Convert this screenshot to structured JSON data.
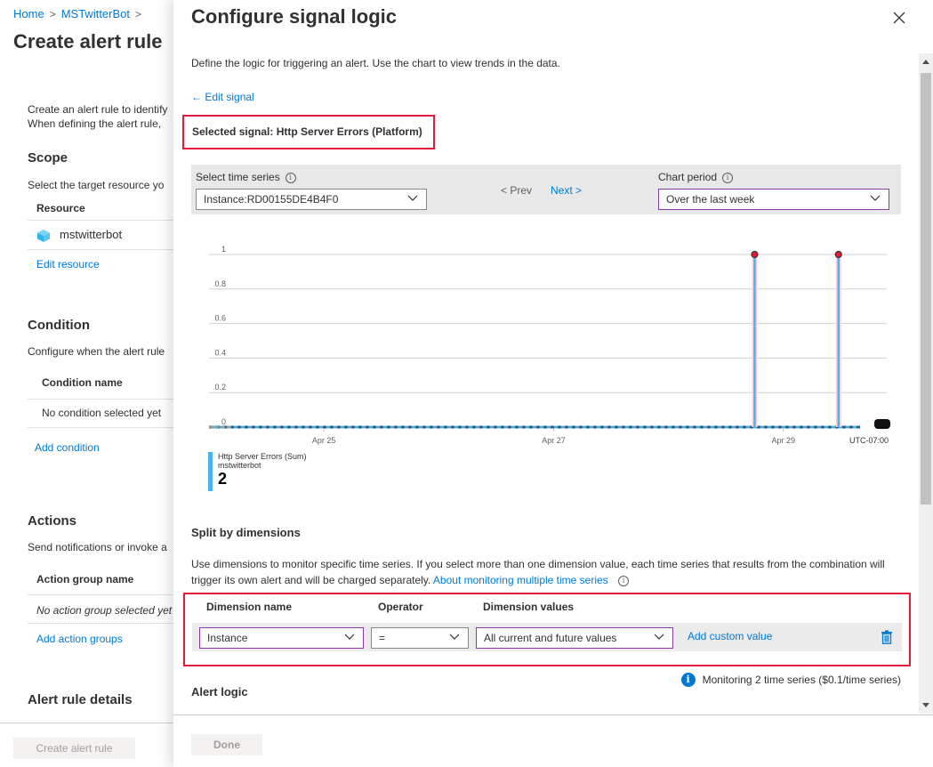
{
  "background": {
    "breadcrumb": [
      {
        "label": "Home"
      },
      {
        "label": "MSTwitterBot"
      }
    ],
    "title": "Create alert rule",
    "intro_line1": "Create an alert rule to identify",
    "intro_line2": "When defining the alert rule,",
    "scope": {
      "heading": "Scope",
      "desc": "Select the target resource yo",
      "column": "Resource",
      "resource": "mstwitterbot",
      "edit_link": "Edit resource"
    },
    "condition": {
      "heading": "Condition",
      "desc": "Configure when the alert rule",
      "column": "Condition name",
      "empty": "No condition selected yet",
      "add_link": "Add condition"
    },
    "actions": {
      "heading": "Actions",
      "desc": "Send notifications or invoke a",
      "column": "Action group name",
      "empty": "No action group selected yet",
      "add_link": "Add action groups"
    },
    "details": {
      "heading": "Alert rule details"
    },
    "create_button": "Create alert rule"
  },
  "panel": {
    "title": "Configure signal logic",
    "description": "Define the logic for triggering an alert. Use the chart to view trends in the data.",
    "edit_signal": "Edit signal",
    "selected_signal": "Selected signal: Http Server Errors (Platform)",
    "time_series": {
      "label": "Select time series",
      "value": "Instance:RD00155DE4B4F0",
      "prev": "< Prev",
      "next": "Next >"
    },
    "chart_period": {
      "label": "Chart period",
      "value": "Over the last week"
    },
    "legend": {
      "metric": "Http Server Errors (Sum)",
      "resource": "mstwitterbot",
      "total": "2"
    },
    "split": {
      "heading": "Split by dimensions",
      "desc": "Use dimensions to monitor specific time series. If you select more than one dimension value, each time series that results from the combination will trigger its own alert and will be charged separately.",
      "link": "About monitoring multiple time series"
    },
    "dimensions": {
      "headers": {
        "name": "Dimension name",
        "operator": "Operator",
        "values": "Dimension values"
      },
      "rows": [
        {
          "name": "Instance",
          "operator": "=",
          "values": "All current and future values",
          "add_custom": "Add custom value"
        }
      ]
    },
    "monitoring_note": "Monitoring 2 time series ($0.1/time series)",
    "alert_logic_heading": "Alert logic",
    "done_button": "Done"
  },
  "colors": {
    "accent": "#0078d4",
    "highlight_border": "#e81a3b",
    "series": "#4cb3e8",
    "dropdown_focus": "#8a3aa8"
  },
  "chart_data": {
    "type": "line",
    "title": "",
    "series": [
      {
        "name": "Http Server Errors (Sum)",
        "resource": "mstwitterbot",
        "spikes": [
          {
            "x_days_from_apr24": 4.75,
            "value": 1
          },
          {
            "x_days_from_apr24": 5.48,
            "value": 1
          }
        ],
        "baseline": 0
      }
    ],
    "y_ticks": [
      "0",
      "0.2",
      "0.4",
      "0.6",
      "0.8",
      "1"
    ],
    "ylim": [
      0,
      1
    ],
    "x_ticks": [
      "Apr 25",
      "Apr 27",
      "Apr 29"
    ],
    "x_range_days_from_apr24": [
      0,
      5.9
    ],
    "timezone": "UTC-07:00",
    "grid": true,
    "legend_position": "bottom-left"
  }
}
